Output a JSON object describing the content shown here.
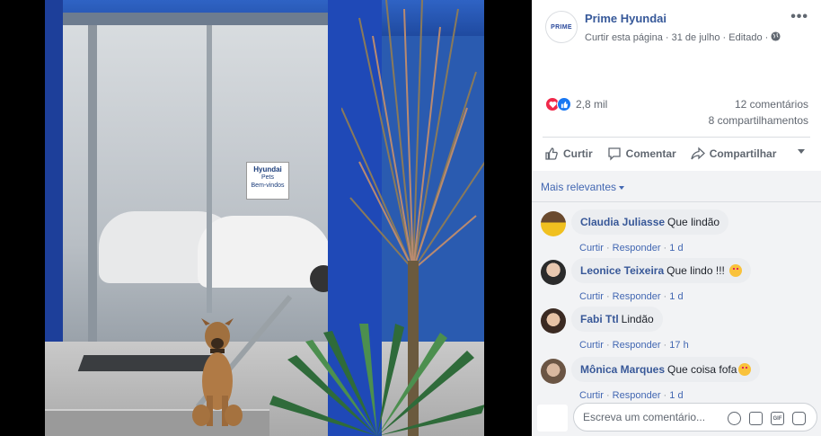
{
  "post": {
    "page_name": "Prime Hyundai",
    "page_avatar_text": "PRIME",
    "like_page": "Curtir esta página",
    "date": "31 de julho",
    "edited": "Editado",
    "separator": "·",
    "more_icon": "more-options-icon"
  },
  "photo": {
    "sign_line1": "Hyundai",
    "sign_line2": "Pets",
    "sign_line3": "Bem-vindos"
  },
  "stats": {
    "reactions_count": "2,8 mil",
    "comments": "12 comentários",
    "shares": "8 compartilhamentos",
    "reaction_types": [
      "love",
      "like"
    ]
  },
  "actions": {
    "like": "Curtir",
    "comment": "Comentar",
    "share": "Compartilhar"
  },
  "comments_section": {
    "sort_label": "Mais relevantes",
    "items": [
      {
        "author": "Claudia Juliasse",
        "text": "Que lindão",
        "like": "Curtir",
        "reply": "Responder",
        "time": "1 d",
        "emoji": false
      },
      {
        "author": "Leonice Teixeira",
        "text": "Que lindo !!! ",
        "like": "Curtir",
        "reply": "Responder",
        "time": "1 d",
        "emoji": true
      },
      {
        "author": "Fabi Ttl",
        "text": "Lindão",
        "like": "Curtir",
        "reply": "Responder",
        "time": "17 h",
        "emoji": false
      },
      {
        "author": "Mônica Marques",
        "text": "Que coisa fofa",
        "like": "Curtir",
        "reply": "Responder",
        "time": "1 d",
        "emoji": true
      }
    ],
    "composer_placeholder": "Escreva um comentário..."
  },
  "colors": {
    "link_blue": "#365899",
    "fb_blue": "#4267b2",
    "love_red": "#f0284a",
    "like_blue": "#1877f2"
  }
}
